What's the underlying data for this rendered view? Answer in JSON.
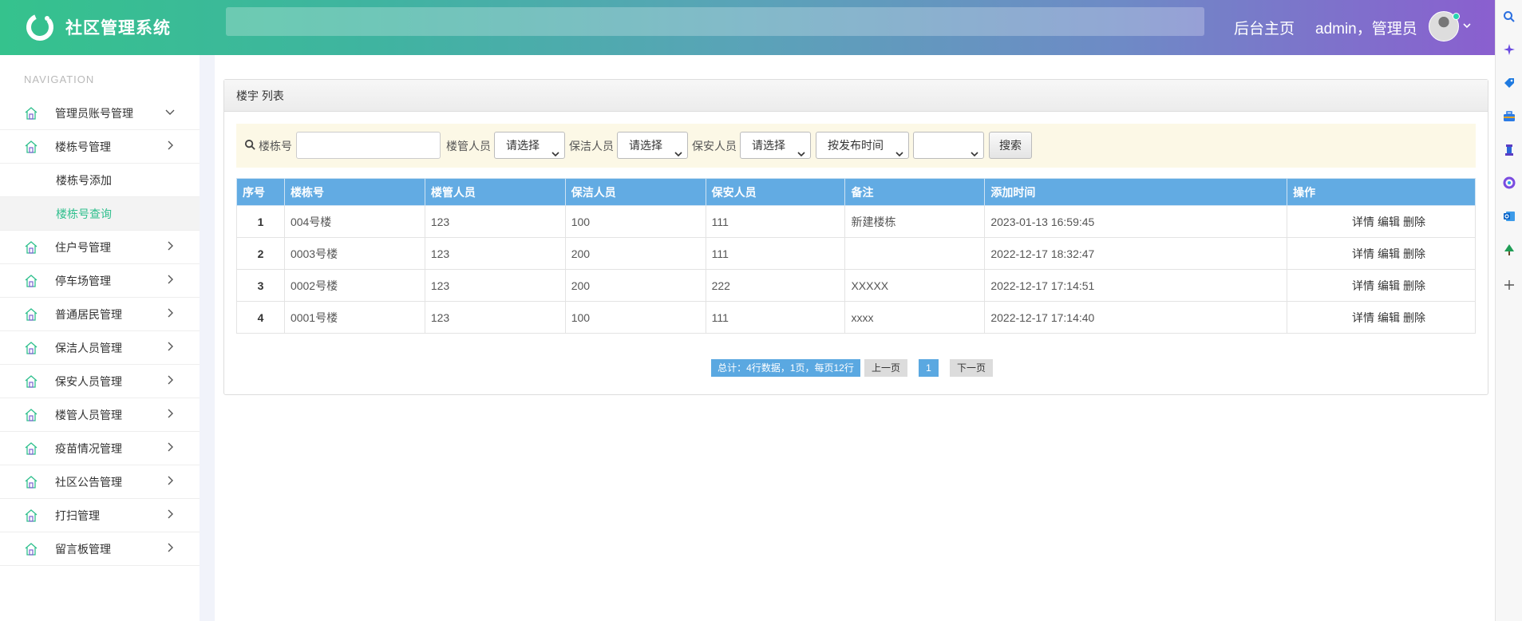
{
  "app": {
    "title": "社区管理系统"
  },
  "header": {
    "home_label": "后台主页",
    "user_label": "admin，管理员"
  },
  "sidebar": {
    "caption": "NAVIGATION",
    "items": [
      {
        "label": "管理员账号管理",
        "expanded": true
      },
      {
        "label": "楼栋号管理",
        "expanded": false
      },
      {
        "label": "住户号管理"
      },
      {
        "label": "停车场管理"
      },
      {
        "label": "普通居民管理"
      },
      {
        "label": "保洁人员管理"
      },
      {
        "label": "保安人员管理"
      },
      {
        "label": "楼管人员管理"
      },
      {
        "label": "疫苗情况管理"
      },
      {
        "label": "社区公告管理"
      },
      {
        "label": "打扫管理"
      },
      {
        "label": "留言板管理"
      }
    ],
    "sub_items": [
      {
        "label": "楼栋号添加",
        "active": false
      },
      {
        "label": "楼栋号查询",
        "active": true
      }
    ]
  },
  "panel": {
    "title": "楼宇 列表"
  },
  "filter": {
    "building_label": "楼栋号",
    "building_value": "",
    "manager_label": "楼管人员",
    "manager_value": "请选择",
    "cleaner_label": "保洁人员",
    "cleaner_value": "请选择",
    "guard_label": "保安人员",
    "guard_value": "请选择",
    "sort_value": "按发布时间",
    "order_value": "",
    "search_label": "搜索"
  },
  "table": {
    "headers": [
      "序号",
      "楼栋号",
      "楼管人员",
      "保洁人员",
      "保安人员",
      "备注",
      "添加时间",
      "操作"
    ],
    "rows": [
      {
        "no": "1",
        "building": "004号楼",
        "manager": "123",
        "cleaner": "100",
        "guard": "111",
        "remark": "新建楼栋",
        "time": "2023-01-13 16:59:45"
      },
      {
        "no": "2",
        "building": "0003号楼",
        "manager": "123",
        "cleaner": "200",
        "guard": "111",
        "remark": "",
        "time": "2022-12-17 18:32:47"
      },
      {
        "no": "3",
        "building": "0002号楼",
        "manager": "123",
        "cleaner": "200",
        "guard": "222",
        "remark": "XXXXX",
        "time": "2022-12-17 17:14:51"
      },
      {
        "no": "4",
        "building": "0001号楼",
        "manager": "123",
        "cleaner": "100",
        "guard": "111",
        "remark": "xxxx",
        "time": "2022-12-17 17:14:40"
      }
    ],
    "actions": {
      "detail": "详情",
      "edit": "编辑",
      "delete": "删除"
    }
  },
  "pager": {
    "total_text": "总计：4行数据，1页，每页12行",
    "prev_label": "上一页",
    "current_page": "1",
    "next_label": "下一页"
  },
  "colors": {
    "brand_green": "#35c28d",
    "brand_purple": "#8a5fcf",
    "table_header": "#62abe3",
    "active_menu": "#2fbf8d"
  },
  "icons": {
    "edge": [
      "search-icon",
      "sparkle-icon",
      "tag-icon",
      "toolbox-icon",
      "chess-icon",
      "office-icon",
      "outlook-icon",
      "tree-icon",
      "plus-icon"
    ]
  }
}
